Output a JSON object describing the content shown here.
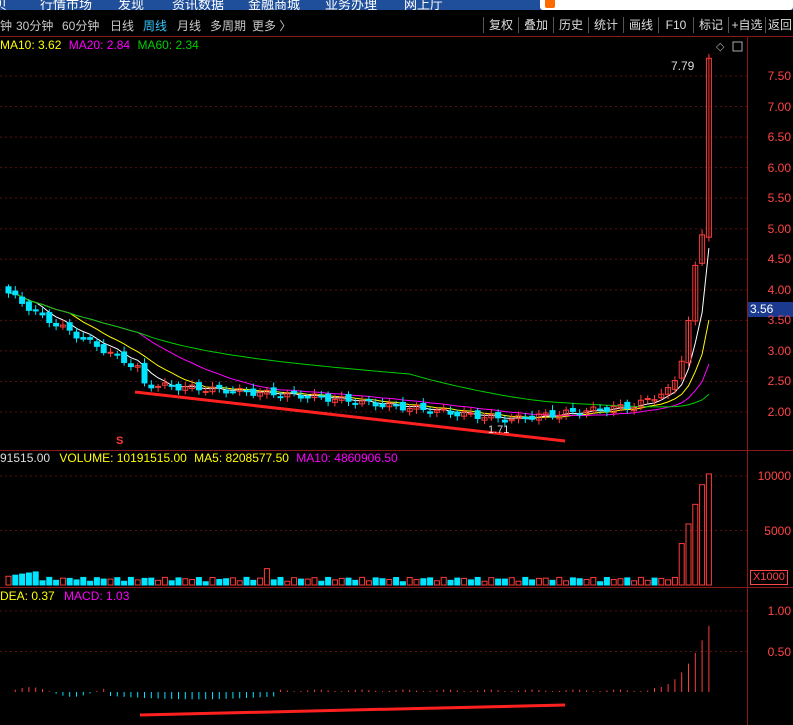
{
  "nav": {
    "items": [
      "行情市场",
      "发现",
      "资讯数据",
      "金融商城",
      "业务办理",
      "网上厅"
    ]
  },
  "toolbar": {
    "periods": [
      "钟",
      "30分钟",
      "60分钟",
      "日线",
      "周线",
      "月线",
      "多周期",
      "更多 〉"
    ],
    "active_period": "周线",
    "buttons": [
      "复权",
      "叠加",
      "历史",
      "统计",
      "画线",
      "F10",
      "标记",
      "+自选",
      "返回"
    ]
  },
  "price_panel": {
    "ma10": "MA10: 3.62",
    "ma20": "MA20: 2.84",
    "ma60": "MA60: 2.34",
    "high_label": "7.79",
    "low_label": "1.71",
    "current_price": "3.56",
    "axis_ticks": [
      "7.50",
      "7.00",
      "6.50",
      "6.00",
      "5.50",
      "5.00",
      "4.50",
      "4.00",
      "3.50",
      "3.00",
      "2.50",
      "2.00"
    ],
    "marker": "S"
  },
  "volume_panel": {
    "prefix": "91515.00",
    "volume": "VOLUME: 10191515.00",
    "ma5": "MA5: 8208577.50",
    "ma10": "MA10: 4860906.50",
    "axis_ticks": [
      "10000",
      "5000"
    ],
    "unit": "X1000"
  },
  "macd_panel": {
    "dea": "DEA: 0.37",
    "macd": "MACD: 1.03",
    "axis_ticks": [
      "1.00",
      "0.50"
    ]
  },
  "colors": {
    "up": "#ff3b3b",
    "down": "#00e5ff",
    "ma5": "#ffffff",
    "ma10": "#ffff00",
    "ma20": "#ff00ff",
    "ma60": "#00d000",
    "active": "#33c7ff",
    "trendline": "#ff2020"
  }
}
